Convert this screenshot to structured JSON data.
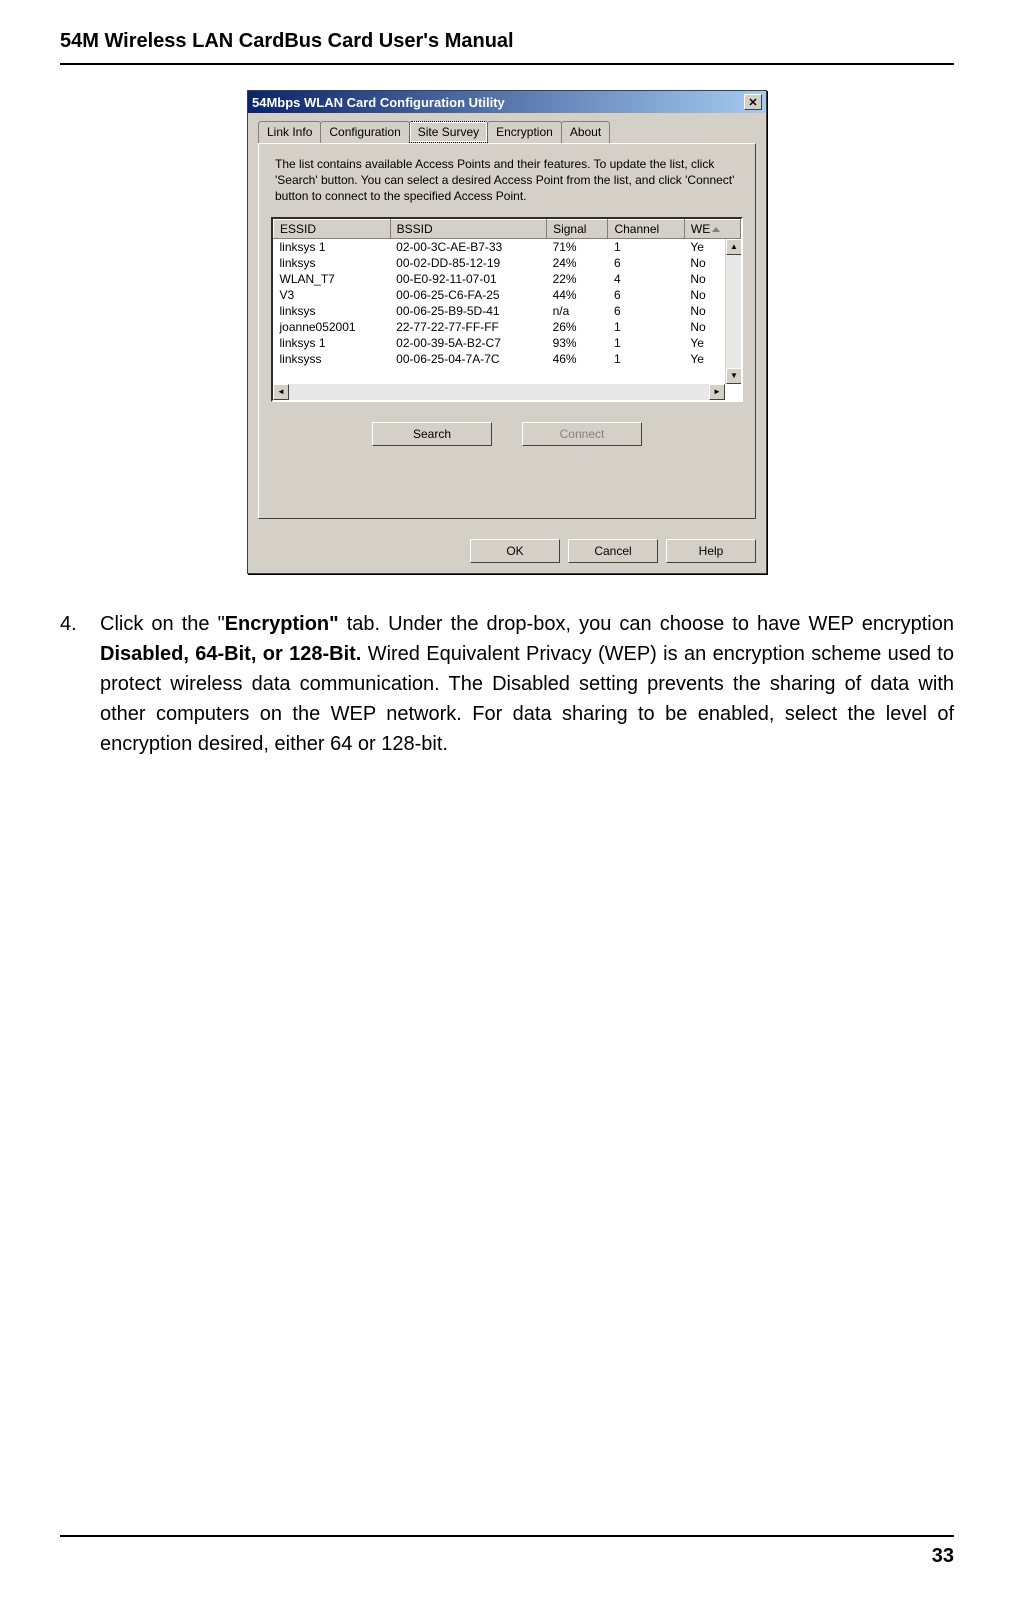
{
  "header": "54M Wireless LAN CardBus Card User's Manual",
  "dialog": {
    "title": "54Mbps WLAN Card Configuration Utility",
    "tabs": [
      "Link Info",
      "Configuration",
      "Site Survey",
      "Encryption",
      "About"
    ],
    "active_tab": "Site Survey",
    "instructions": "The list contains available Access Points and their features. To update the list, click 'Search' button. You can select a desired Access Point from the list, and click 'Connect' button to connect to the specified Access Point.",
    "columns": [
      "ESSID",
      "BSSID",
      "Signal",
      "Channel",
      "WE"
    ],
    "rows": [
      {
        "essid": "linksys 1",
        "bssid": "02-00-3C-AE-B7-33",
        "signal": "71%",
        "channel": "1",
        "wep": "Ye"
      },
      {
        "essid": "linksys",
        "bssid": "00-02-DD-85-12-19",
        "signal": "24%",
        "channel": "6",
        "wep": "No"
      },
      {
        "essid": "WLAN_T7",
        "bssid": "00-E0-92-11-07-01",
        "signal": "22%",
        "channel": "4",
        "wep": "No"
      },
      {
        "essid": "V3",
        "bssid": "00-06-25-C6-FA-25",
        "signal": "44%",
        "channel": "6",
        "wep": "No"
      },
      {
        "essid": "linksys",
        "bssid": "00-06-25-B9-5D-41",
        "signal": "n/a",
        "channel": "6",
        "wep": "No"
      },
      {
        "essid": "joanne052001",
        "bssid": "22-77-22-77-FF-FF",
        "signal": "26%",
        "channel": "1",
        "wep": "No"
      },
      {
        "essid": "linksys 1",
        "bssid": "02-00-39-5A-B2-C7",
        "signal": "93%",
        "channel": "1",
        "wep": "Ye"
      },
      {
        "essid": "linksyss",
        "bssid": "00-06-25-04-7A-7C",
        "signal": "46%",
        "channel": "1",
        "wep": "Ye"
      }
    ],
    "buttons": {
      "search": "Search",
      "connect": "Connect"
    },
    "bottom": {
      "ok": "OK",
      "cancel": "Cancel",
      "help": "Help"
    }
  },
  "step": {
    "number": "4.",
    "text_pre": "Click on the \"",
    "bold1": "Encryption\"",
    "text_mid": " tab. Under the drop-box, you can choose to have WEP encryption ",
    "bold2": "Disabled, 64-Bit, or 128-Bit.",
    "text_post": " Wired Equivalent Privacy (WEP) is an encryption scheme used to protect wireless data communication. The Disabled setting prevents the sharing of data with other computers on the WEP network. For data sharing to be enabled, select the level of encryption desired, either 64 or 128-bit."
  },
  "page_number": "33"
}
